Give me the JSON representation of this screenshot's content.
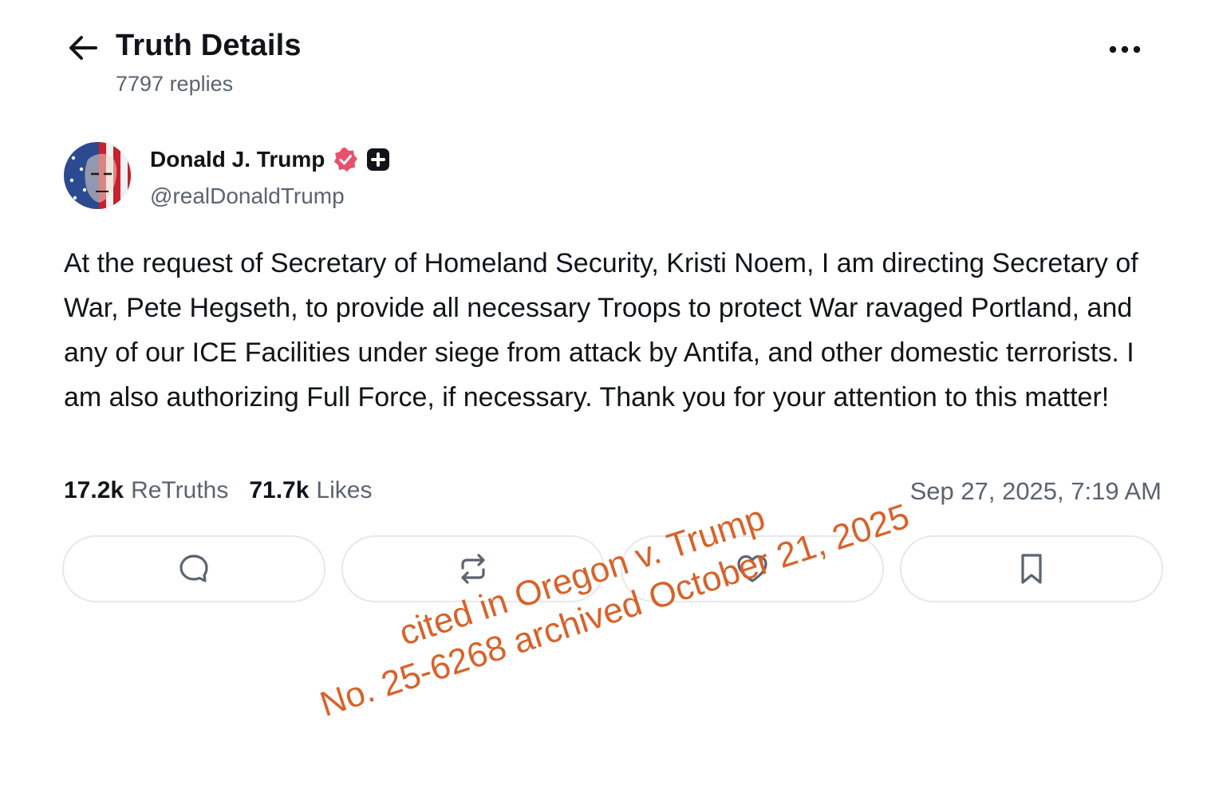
{
  "header": {
    "title": "Truth Details",
    "replies": "7797 replies"
  },
  "author": {
    "name": "Donald J. Trump",
    "handle": "@realDonaldTrump"
  },
  "post": {
    "text": "At the request of Secretary of Homeland Security, Kristi Noem, I am directing Secretary of War, Pete Hegseth, to provide all necessary Troops to protect War ravaged Portland, and any of our ICE Facilities under siege from attack by Antifa, and other domestic terrorists. I am also authorizing Full Force, if necessary. Thank you for your attention to this matter!"
  },
  "stats": {
    "retruths_count": "17.2k",
    "retruths_label": "ReTruths",
    "likes_count": "71.7k",
    "likes_label": "Likes",
    "timestamp": "Sep 27, 2025, 7:19 AM"
  },
  "actions": [
    {
      "icon": "reply-icon"
    },
    {
      "icon": "retruth-icon"
    },
    {
      "icon": "heart-icon"
    },
    {
      "icon": "bookmark-icon"
    }
  ],
  "annotation": {
    "line1": "cited in Oregon v. Trump",
    "line2": "No. 25-6268 archived October 21, 2025",
    "color": "#d8622a"
  },
  "colors": {
    "verified": "#e8506b",
    "muted_text": "#5b6370"
  }
}
